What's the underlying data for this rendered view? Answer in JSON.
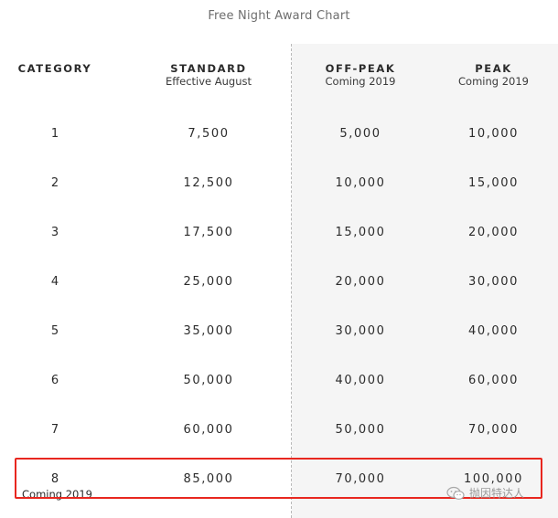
{
  "title": "Free Night Award Chart",
  "headers": {
    "category": "CATEGORY",
    "standard": "STANDARD",
    "standard_sub": "Effective August",
    "off_peak": "OFF-PEAK",
    "off_peak_sub": "Coming 2019",
    "peak": "PEAK",
    "peak_sub": "Coming 2019"
  },
  "rows": [
    {
      "category": "1",
      "standard": "7,500",
      "off_peak": "5,000",
      "peak": "10,000"
    },
    {
      "category": "2",
      "standard": "12,500",
      "off_peak": "10,000",
      "peak": "15,000"
    },
    {
      "category": "3",
      "standard": "17,500",
      "off_peak": "15,000",
      "peak": "20,000"
    },
    {
      "category": "4",
      "standard": "25,000",
      "off_peak": "20,000",
      "peak": "30,000"
    },
    {
      "category": "5",
      "standard": "35,000",
      "off_peak": "30,000",
      "peak": "40,000"
    },
    {
      "category": "6",
      "standard": "50,000",
      "off_peak": "40,000",
      "peak": "60,000"
    },
    {
      "category": "7",
      "standard": "60,000",
      "off_peak": "50,000",
      "peak": "70,000"
    },
    {
      "category": "8",
      "standard": "85,000",
      "off_peak": "70,000",
      "peak": "100,000"
    }
  ],
  "row8_note": "Coming 2019",
  "watermark": "抛因特达人",
  "colors": {
    "highlight": "#e8271f",
    "panel": "#f5f5f5",
    "divider": "#b9b9b9"
  },
  "icons": {
    "watermark": "wechat-icon"
  }
}
